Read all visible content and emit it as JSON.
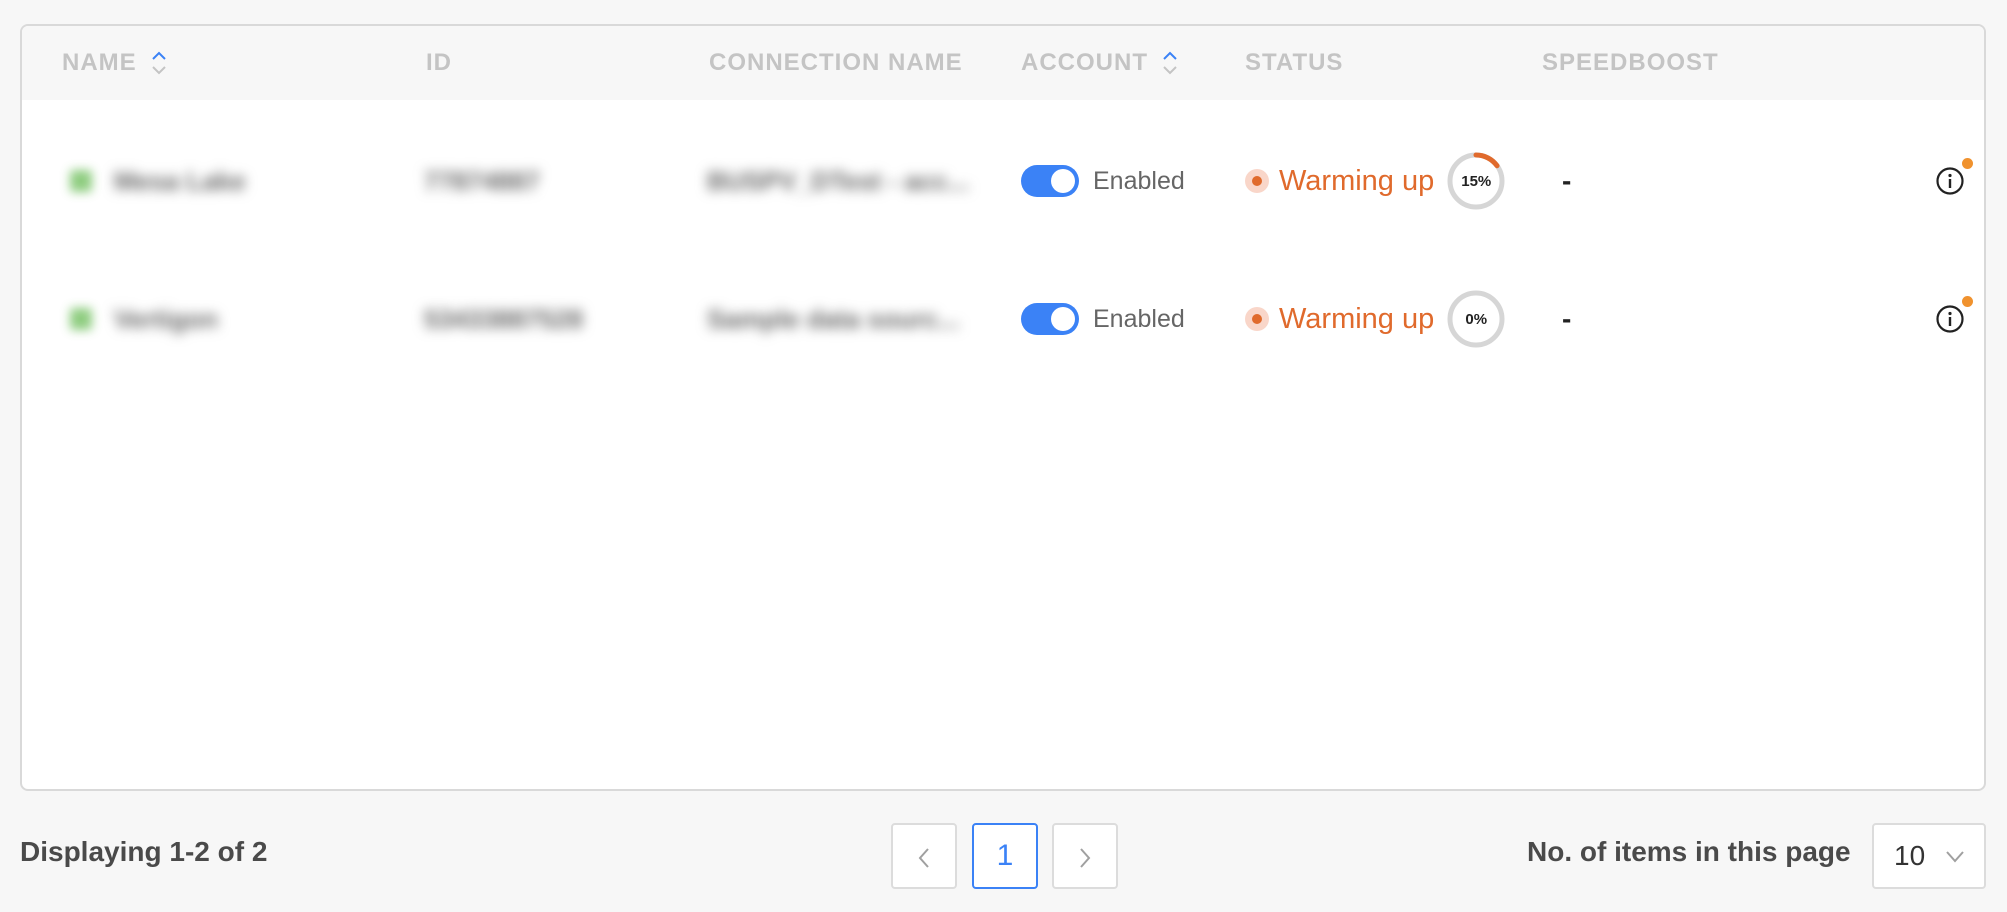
{
  "table": {
    "columns": {
      "name": "NAME",
      "id": "ID",
      "connection_name": "CONNECTION NAME",
      "account": "ACCOUNT",
      "status": "STATUS",
      "speedboost": "SPEEDBOOST"
    },
    "rows": [
      {
        "name": "Mesa Lake",
        "id": "77874887",
        "connection_name": "BUSPV_DTest - acc...",
        "account_state": "Enabled",
        "account_enabled": true,
        "status": "Warming up",
        "progress_label": "15%",
        "progress": 0.15,
        "speedboost": "-"
      },
      {
        "name": "Vertigon",
        "id": "53433887528",
        "connection_name": "Sample data sourc...",
        "account_state": "Enabled",
        "account_enabled": true,
        "status": "Warming up",
        "progress_label": "0%",
        "progress": 0.0,
        "speedboost": "-"
      }
    ]
  },
  "footer": {
    "displaying": "Displaying 1-2 of 2",
    "current_page": "1",
    "items_label": "No. of items in this page",
    "page_size": "10"
  },
  "colors": {
    "accent": "#3b82f6",
    "status_warning": "#e06a2c",
    "badge": "#f0922e"
  },
  "icons": {
    "sort": "sort-icon",
    "info": "info-icon",
    "prev": "chevron-left-icon",
    "next": "chevron-right-icon",
    "dropdown": "chevron-down-icon"
  }
}
